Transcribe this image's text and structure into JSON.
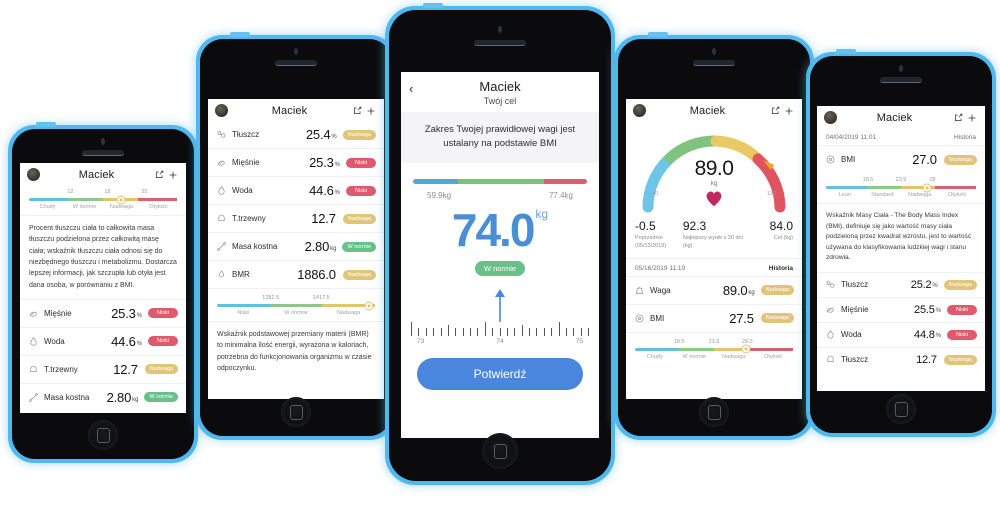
{
  "app": {
    "user_name": "Maciek",
    "icons": {
      "avatar": "avatar-icon",
      "share": "share-icon",
      "add": "plus-icon",
      "back": "back-chevron-icon"
    }
  },
  "colors": {
    "bezel": "#4fb8ef",
    "accent_blue": "#4a86dd",
    "scale_lean": "#63bfe0",
    "scale_normal": "#8cc88a",
    "scale_over": "#e3c46a",
    "scale_obese": "#d9606f",
    "badge_low": "#e05a6e",
    "badge_over": "#dfc479",
    "badge_norm": "#68c08a"
  },
  "phone1": {
    "title": "Maciek",
    "scale": {
      "ticks": [
        "12",
        "18",
        "25"
      ],
      "labels": [
        "Chudy",
        "W normie",
        "Nadwaga",
        "Otyłość"
      ],
      "knob_pct": 62
    },
    "paragraph": "Procent tłuszczu ciała to całkowita masa tłuszczu podzielona przez całkowitą masę ciała; wskaźnik tłuszczu ciała odnosi się do niezbędnego tłuszczu i metabolizmu. Dostarcza lepszej informacji, jak szczupła lub otyła jest dana osoba, w porównaniu z BMI.",
    "rows": [
      {
        "icon": "muscle-icon",
        "label": "Mięśnie",
        "value": "25.3",
        "unit": "%",
        "badge": "Niski",
        "badge_type": "low"
      },
      {
        "icon": "water-icon",
        "label": "Woda",
        "value": "44.6",
        "unit": "%",
        "badge": "Niski",
        "badge_type": "low"
      },
      {
        "icon": "organ-icon",
        "label": "T.trzewny",
        "value": "12.7",
        "unit": "",
        "badge": "Nadwaga",
        "badge_type": "over"
      },
      {
        "icon": "bone-icon",
        "label": "Masa kostna",
        "value": "2.80",
        "unit": "kg",
        "badge": "W normie",
        "badge_type": "norm"
      }
    ]
  },
  "phone2": {
    "title": "Maciek",
    "rows": [
      {
        "icon": "fat-icon",
        "label": "Tłuszcz",
        "value": "25.4",
        "unit": "%",
        "badge": "Nadwaga",
        "badge_type": "over"
      },
      {
        "icon": "muscle-icon",
        "label": "Mięśnie",
        "value": "25.3",
        "unit": "%",
        "badge": "Niski",
        "badge_type": "low"
      },
      {
        "icon": "water-icon",
        "label": "Woda",
        "value": "44.6",
        "unit": "%",
        "badge": "Niski",
        "badge_type": "low"
      },
      {
        "icon": "organ-icon",
        "label": "T.trzewny",
        "value": "12.7",
        "unit": "",
        "badge": "Nadwaga",
        "badge_type": "over"
      },
      {
        "icon": "bone-icon",
        "label": "Masa kostna",
        "value": "2.80",
        "unit": "kg",
        "badge": "W normie",
        "badge_type": "norm"
      },
      {
        "icon": "bmr-icon",
        "label": "BMR",
        "value": "1886.0",
        "unit": "",
        "badge": "Nadwaga",
        "badge_type": "over"
      }
    ],
    "scale": {
      "ticks": [
        "1282.5",
        "1417.5"
      ],
      "labels": [
        "Niski",
        "W normie",
        "Nadwaga"
      ],
      "knob_pct": 96
    },
    "paragraph": "Wskaźnik podstawowej przemiany materii (BMR) to minimalna ilość energii, wyrażona w kaloriach, potrzebna do funkcjonowania organizmu w czasie odpoczynku."
  },
  "phone3": {
    "title": "Maciek",
    "subtitle": "Twój cel",
    "note": "Zakres Twojej prawidłowej wagi jest ustalany na podstawie BMI",
    "range_min": "59.9kg",
    "range_max": "77.4kg",
    "goal_value": "74.0",
    "goal_unit": "kg",
    "status": "W normie",
    "ruler_labels": [
      "73",
      "74",
      "75"
    ],
    "confirm_label": "Potwierdź"
  },
  "phone4": {
    "title": "Maciek",
    "gauge": {
      "value": "89.0",
      "unit": "kg",
      "min": "40",
      "max": "130"
    },
    "stats": [
      {
        "num": "-0.5",
        "caption": "Poprzednio (05/13/2019)"
      },
      {
        "num": "92.3",
        "caption": "Najlepszy wynik z 30 dni (kg)"
      },
      {
        "num": "84.0",
        "caption": "Cel (kg)"
      }
    ],
    "date": "05/16/2019 11:19",
    "history_label": "Historia",
    "rows": [
      {
        "icon": "weight-icon",
        "label": "Waga",
        "value": "89.0",
        "unit": "kg",
        "badge": "Nadwaga",
        "badge_type": "over"
      },
      {
        "icon": "bmi-icon",
        "label": "BMI",
        "value": "27.5",
        "unit": "",
        "badge": "Nadwaga",
        "badge_type": "over"
      }
    ],
    "scale": {
      "ticks": [
        "18.5",
        "23.9",
        "28.0"
      ],
      "labels": [
        "Chudy",
        "W normie",
        "Nadwaga",
        "Otyłość"
      ],
      "knob_pct": 70
    }
  },
  "phone5": {
    "title": "Maciek",
    "date": "04/04/2019 11:01",
    "history_label": "Historia",
    "bmi_row": {
      "icon": "bmi-icon",
      "label": "BMI",
      "value": "27.0",
      "unit": "",
      "badge": "Nadwaga",
      "badge_type": "over"
    },
    "scale": {
      "ticks": [
        "18.5",
        "23.9",
        "28"
      ],
      "labels": [
        "Lean",
        "Standard",
        "Nadwaga",
        "Otyłość"
      ],
      "knob_pct": 67
    },
    "paragraph": "Wskaźnik Masy Ciała - The Body Mass Index (BMI),  definiuje się jako wartość masy ciała podzieloną przez kwadrat wzrostu, jest to wartość używana do klasyfikowania ludzkiej wagi i stanu zdrowia.",
    "rows": [
      {
        "icon": "fat-icon",
        "label": "Tłuszcz",
        "value": "25.2",
        "unit": "%",
        "badge": "Nadwaga",
        "badge_type": "over"
      },
      {
        "icon": "muscle-icon",
        "label": "Mięśnie",
        "value": "25.5",
        "unit": "%",
        "badge": "Niski",
        "badge_type": "low"
      },
      {
        "icon": "water-icon",
        "label": "Woda",
        "value": "44.8",
        "unit": "%",
        "badge": "Niski",
        "badge_type": "low"
      },
      {
        "icon": "organ-icon",
        "label": "Tłuszcz",
        "value": "12.7",
        "unit": "",
        "badge": "Nadwaga",
        "badge_type": "over"
      }
    ]
  }
}
